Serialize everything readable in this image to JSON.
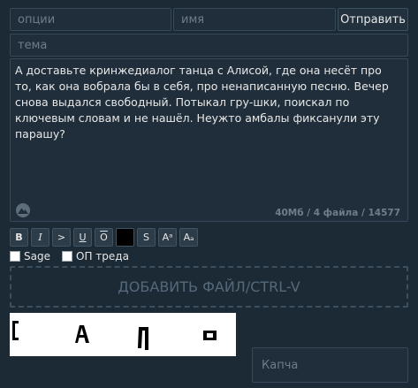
{
  "form": {
    "options_placeholder": "опции",
    "name_placeholder": "имя",
    "send_label": "Отправить",
    "subject_placeholder": "тема",
    "message": "А доставьте кринжедиалог танца с Алисой, где она несёт про то, как она вобрала бы в себя, про ненаписанную песню. Вечер снова выдался свободный. Потыкал гру-шки, поискал по ключевым словам и не нашёл. Неужто амбалы фиксанули эту парашу?",
    "counter": "40Мб / 4 файла / 14577",
    "toolbar": [
      "B",
      "I",
      ">",
      "U",
      "O",
      "█",
      "S",
      "Aᵃ",
      "Aₐ"
    ],
    "sage_label": "Sage",
    "op_label": "ОП треда",
    "dropzone_label": "ДОБАВИТЬ ФАЙЛ/CTRL-V",
    "captcha_placeholder": "Капча"
  },
  "colors": {
    "background": "#1c2a35",
    "field_bg": "#1f2e3a",
    "field_border": "#35495a",
    "muted_text": "#6f7d88"
  },
  "icons": {
    "message_corner": "mountain-icon"
  }
}
